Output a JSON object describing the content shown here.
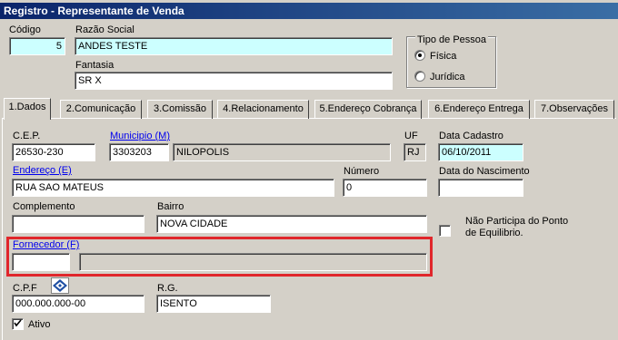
{
  "window": {
    "title": "Registro - Representante de Venda"
  },
  "header": {
    "codigo_label": "Código",
    "codigo_value": "5",
    "razao_label": "Razão Social",
    "razao_value": "ANDES TESTE",
    "fantasia_label": "Fantasia",
    "fantasia_value": "SR X",
    "tipo_pessoa": {
      "title": "Tipo de Pessoa",
      "options": [
        {
          "label": "Física",
          "selected": true
        },
        {
          "label": "Jurídica",
          "selected": false
        }
      ]
    }
  },
  "tabs": [
    {
      "label": "1.Dados"
    },
    {
      "label": "2.Comunicação"
    },
    {
      "label": "3.Comissão"
    },
    {
      "label": "4.Relacionamento"
    },
    {
      "label": "5.Endereço Cobrança"
    },
    {
      "label": "6.Endereço Entrega"
    },
    {
      "label": "7.Observações"
    }
  ],
  "dados": {
    "cep_label": "C.E.P.",
    "cep_value": "26530-230",
    "municipio_label": "Municipio (M)",
    "municipio_code": "3303203",
    "municipio_name": "NILOPOLIS",
    "uf_label": "UF",
    "uf_value": "RJ",
    "data_cadastro_label": "Data Cadastro",
    "data_cadastro_value": "06/10/2011",
    "endereco_label": "Endereço (E)",
    "endereco_value": "RUA SAO MATEUS",
    "numero_label": "Número",
    "numero_value": "0",
    "nascimento_label": "Data do Nascimento",
    "nascimento_value": "",
    "complemento_label": "Complemento",
    "complemento_value": "",
    "bairro_label": "Bairro",
    "bairro_value": "NOVA CIDADE",
    "ponto_equilibrio_label_1": "Não Participa do Ponto",
    "ponto_equilibrio_label_2": "de Equilibrio.",
    "ponto_equilibrio_checked": false,
    "fornecedor_label": "Fornecedor (F)",
    "fornecedor_code": "",
    "fornecedor_name": "",
    "cpf_label": "C.P.F",
    "cpf_value": "000.000.000-00",
    "rg_label": "R.G.",
    "rg_value": "ISENTO",
    "ativo_label": "Ativo",
    "ativo_checked": true
  },
  "colors": {
    "highlight": "#e0262b",
    "title_bar": "#0a246a",
    "required_field": "#ccffff"
  }
}
